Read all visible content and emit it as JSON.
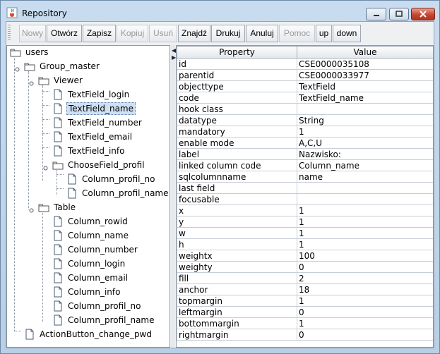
{
  "window": {
    "title": "Repository"
  },
  "toolbar": {
    "buttons": [
      {
        "label": "Nowy",
        "enabled": false
      },
      {
        "label": "Otwórz",
        "enabled": true
      },
      {
        "label": "Zapisz",
        "enabled": true
      },
      {
        "label": "Kopiuj",
        "enabled": false
      },
      {
        "label": "Usuń",
        "enabled": false
      },
      {
        "label": "Znajdź",
        "enabled": true
      },
      {
        "label": "Drukuj",
        "enabled": true
      },
      {
        "label": "Anuluj",
        "enabled": true
      },
      {
        "label": "Pomoc",
        "enabled": false
      },
      {
        "label": "up",
        "enabled": true
      },
      {
        "label": "down",
        "enabled": true
      }
    ]
  },
  "tree": {
    "nodes": [
      {
        "label": "users",
        "type": "folder",
        "depth": 0
      },
      {
        "label": "Group_master",
        "type": "folder",
        "depth": 1
      },
      {
        "label": "Viewer",
        "type": "folder",
        "depth": 2
      },
      {
        "label": "TextField_login",
        "type": "file",
        "depth": 3
      },
      {
        "label": "TextField_name",
        "type": "file",
        "depth": 3,
        "selected": true
      },
      {
        "label": "TextField_number",
        "type": "file",
        "depth": 3
      },
      {
        "label": "TextField_email",
        "type": "file",
        "depth": 3
      },
      {
        "label": "TextField_info",
        "type": "file",
        "depth": 3
      },
      {
        "label": "ChooseField_profil",
        "type": "folder",
        "depth": 3
      },
      {
        "label": "Column_profil_no",
        "type": "file",
        "depth": 4
      },
      {
        "label": "Column_profil_name",
        "type": "file",
        "depth": 4
      },
      {
        "label": "Table",
        "type": "folder",
        "depth": 2
      },
      {
        "label": "Column_rowid",
        "type": "file",
        "depth": 3
      },
      {
        "label": "Column_name",
        "type": "file",
        "depth": 3
      },
      {
        "label": "Column_number",
        "type": "file",
        "depth": 3
      },
      {
        "label": "Column_login",
        "type": "file",
        "depth": 3
      },
      {
        "label": "Column_email",
        "type": "file",
        "depth": 3
      },
      {
        "label": "Column_info",
        "type": "file",
        "depth": 3
      },
      {
        "label": "Column_profil_no",
        "type": "file",
        "depth": 3
      },
      {
        "label": "Column_profil_name",
        "type": "file",
        "depth": 3
      },
      {
        "label": "ActionButton_change_pwd",
        "type": "file",
        "depth": 1
      }
    ]
  },
  "properties": {
    "headers": {
      "property": "Property",
      "value": "Value"
    },
    "rows": [
      [
        "id",
        "CSE0000035108"
      ],
      [
        "parentid",
        "CSE0000033977"
      ],
      [
        "objecttype",
        "TextField"
      ],
      [
        "code",
        "TextField_name"
      ],
      [
        "hook class",
        ""
      ],
      [
        "datatype",
        "String"
      ],
      [
        "mandatory",
        "1"
      ],
      [
        "enable mode",
        "A,C,U"
      ],
      [
        "label",
        "Nazwisko:"
      ],
      [
        "linked column code",
        "Column_name"
      ],
      [
        "sqlcolumnname",
        "name"
      ],
      [
        "last field",
        ""
      ],
      [
        "focusable",
        ""
      ],
      [
        "x",
        "1"
      ],
      [
        "y",
        "1"
      ],
      [
        "w",
        "1"
      ],
      [
        "h",
        "1"
      ],
      [
        "weightx",
        "100"
      ],
      [
        "weighty",
        "0"
      ],
      [
        "fill",
        "2"
      ],
      [
        "anchor",
        "18"
      ],
      [
        "topmargin",
        "1"
      ],
      [
        "leftmargin",
        "0"
      ],
      [
        "bottommargin",
        "1"
      ],
      [
        "rightmargin",
        "0"
      ]
    ]
  },
  "colors": {
    "selection": "#cfe0f3",
    "folder": "#ffffff",
    "close_button": "#c7452f"
  }
}
